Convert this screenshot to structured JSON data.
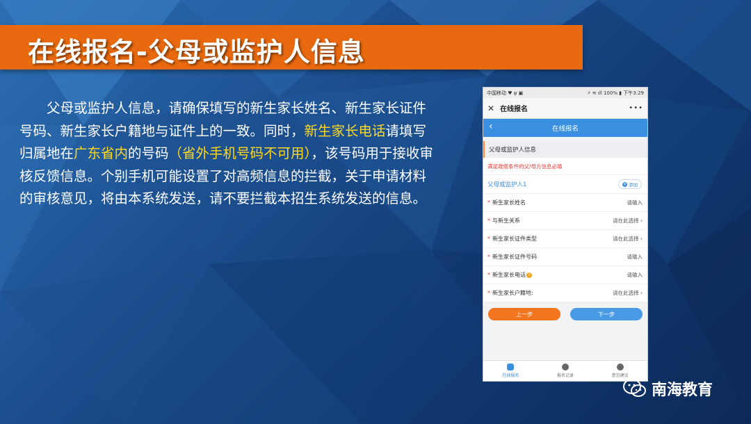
{
  "slide": {
    "title": "在线报名-父母或监护人信息",
    "paragraph": [
      {
        "text": "　　父母或监护人信息，请确保填写的新生家长姓名、新生家长证件号码、新生家长户籍地与证件上的一致。同时，",
        "hl": false
      },
      {
        "text": "新生家长电话",
        "hl": true
      },
      {
        "text": "请填写归属地在",
        "hl": false
      },
      {
        "text": "广东省内",
        "hl": true
      },
      {
        "text": "的号码",
        "hl": false
      },
      {
        "text": "（省外手机号码不可用）",
        "hl": true
      },
      {
        "text": "，该号码用于接收审核反馈信息。个别手机可能设置了对高频信息的拦截，关于申请材料的审核意见，将由本系统发送，请不要拦截本招生系统发送的信息。",
        "hl": false
      }
    ],
    "highlight_color": "#ffd820",
    "title_bar_color": "#e8690f"
  },
  "phone": {
    "status_left": "中国移动 ♥ ψ ▣",
    "status_right": "⚡ ≋ ıll 100% ▮ 下午3:29",
    "wx_title": "在线报名",
    "app_title": "在线报名",
    "section_header": "父母或监护人信息",
    "notice": "满足政借条件的父/母方信息必填",
    "guardian_label": "父母或监护人1",
    "add_label": "添加",
    "fields": [
      {
        "label": "新生家长姓名",
        "value": "请输入",
        "required": true,
        "help": false
      },
      {
        "label": "与新生关系",
        "value": "请在此选择 ›",
        "required": true,
        "help": false
      },
      {
        "label": "新生家长证件类型",
        "value": "请在此选择 ›",
        "required": true,
        "help": false
      },
      {
        "label": "新生家长证件号码",
        "value": "请输入",
        "required": true,
        "help": false
      },
      {
        "label": "新生家长电话",
        "value": "请输入",
        "required": true,
        "help": true
      },
      {
        "label": "新生家长户籍地:",
        "value": "请在此选择 ›",
        "required": true,
        "help": false
      }
    ],
    "prev_button": "上一步",
    "next_button": "下一步",
    "tabs": [
      {
        "label": "在线报名",
        "icon": "online-apply-icon",
        "active": true
      },
      {
        "label": "报名记录",
        "icon": "record-icon",
        "active": false
      },
      {
        "label": "意见建议",
        "icon": "feedback-icon",
        "active": false
      }
    ]
  },
  "brand": {
    "name": "南海教育",
    "icon": "wechat-icon"
  }
}
